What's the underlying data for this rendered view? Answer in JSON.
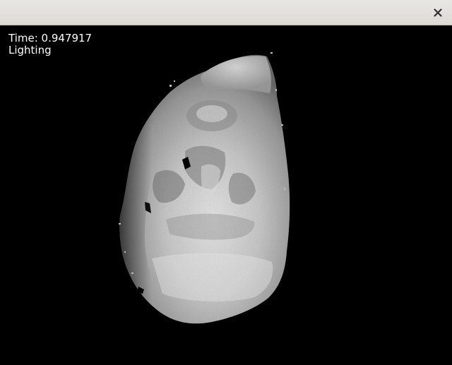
{
  "window": {
    "close_icon": "close-icon"
  },
  "hud": {
    "time_text": "Time: 0.947917",
    "mode_text": "Lighting"
  },
  "scene": {
    "object": "3d-scanned-surface",
    "background_color": "#000000",
    "surface_color": "#c8c8c8"
  }
}
